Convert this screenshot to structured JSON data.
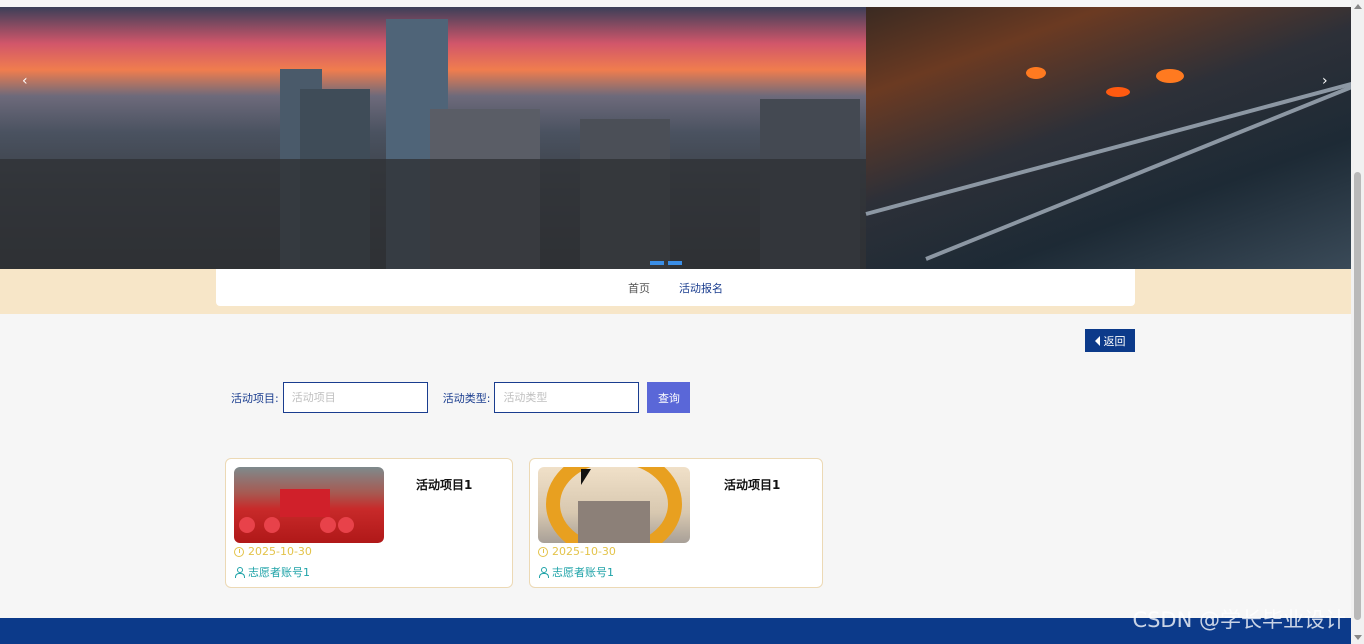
{
  "nav": {
    "items": [
      "首页",
      "活动报名"
    ]
  },
  "back_button": {
    "label": "返回"
  },
  "search": {
    "project_label": "活动项目:",
    "project_placeholder": "活动项目",
    "type_label": "活动类型:",
    "type_placeholder": "活动类型",
    "query_label": "查询"
  },
  "cards": [
    {
      "title": "活动项目1",
      "date": "2025-10-30",
      "user": "志愿者账号1"
    },
    {
      "title": "活动项目1",
      "date": "2025-10-30",
      "user": "志愿者账号1"
    }
  ],
  "watermark": "CSDN @学长毕业设计",
  "colors": {
    "primary": "#0c3a8a",
    "query_button": "#5a67d8",
    "nav_strip": "#f7e6c8"
  }
}
